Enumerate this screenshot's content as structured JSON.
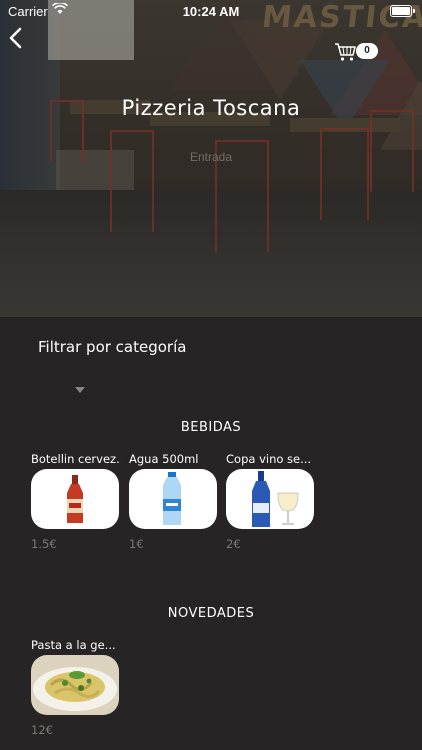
{
  "status_bar": {
    "carrier": "Carrier",
    "time": "10:24 AM"
  },
  "hero": {
    "title": "Pizzeria Toscana",
    "subtitle": "Entrada",
    "cart_count": "0",
    "sign_text": "MASTICA"
  },
  "filter": {
    "label": "Filtrar por categoría",
    "selected": ""
  },
  "sections": [
    {
      "title": "BEBIDAS",
      "products": [
        {
          "name": "Botellin cervez...",
          "price": "1.5€",
          "image": "beer-bottle"
        },
        {
          "name": "Agua 500ml",
          "price": "1€",
          "image": "water-bottle"
        },
        {
          "name": "Copa vino se...",
          "price": "2€",
          "image": "wine-glass"
        }
      ]
    },
    {
      "title": "NOVEDADES",
      "products": [
        {
          "name": "Pasta a la ge...",
          "price": "12€",
          "image": "pasta-dish"
        }
      ]
    }
  ],
  "colors": {
    "background": "#262424",
    "price": "#7c7976",
    "accent_red": "#c9342a"
  }
}
